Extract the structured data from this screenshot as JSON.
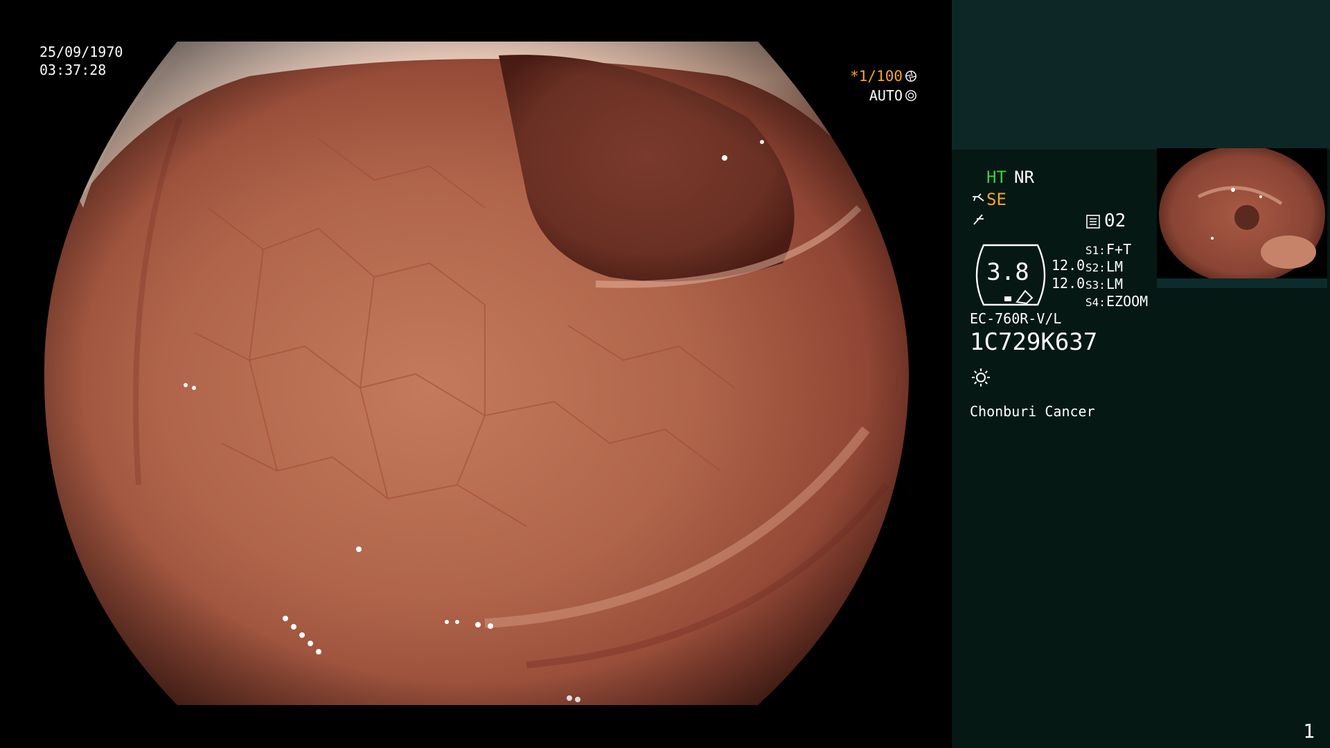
{
  "overlay": {
    "date": "25/09/1970",
    "time": "03:37:28",
    "shutter": "*1/100",
    "iris_mode": "AUTO"
  },
  "info_panel": {
    "enhancement": "HT",
    "noise_reduction": "NR",
    "structure_enhancement": "SE",
    "memory_slot": "02",
    "gauge_value": "3.8",
    "gauge_side_top": "12.0",
    "gauge_side_bottom": "12.0",
    "switches": [
      {
        "key": "S1:",
        "value": "F+T"
      },
      {
        "key": "S2:",
        "value": "LM"
      },
      {
        "key": "S3:",
        "value": "LM"
      },
      {
        "key": "S4:",
        "value": "EZOOM"
      }
    ],
    "scope_model": "EC-760R-V/L",
    "scope_serial": "1C729K637",
    "hospital": "Chonburi Cancer",
    "page_number": "1"
  },
  "colors": {
    "panel_background": "#051814",
    "panel_top_block": "#0d2727",
    "ht_green": "#3ccf3c",
    "accent_orange": "#f5a623",
    "tissue": "#b8674a"
  },
  "icons": [
    "shutter-icon",
    "iris-icon",
    "se-icon",
    "flex-icon",
    "memory-icon",
    "light-icon"
  ]
}
